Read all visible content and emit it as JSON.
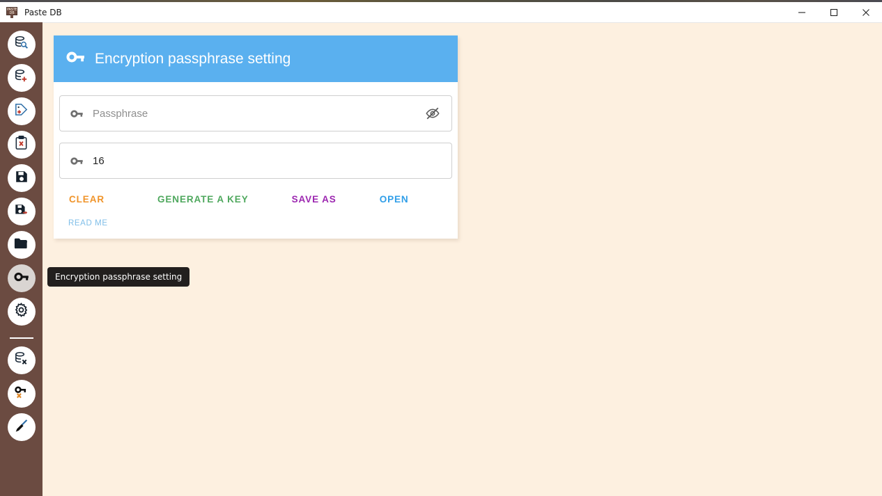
{
  "window": {
    "title": "Paste DB",
    "app_icon": "paste-db-sign-icon",
    "controls": {
      "minimize": "minimize-icon",
      "maximize": "maximize-icon",
      "close": "close-icon"
    }
  },
  "colors": {
    "sidebar_bg": "#6B4B41",
    "page_bg": "#FDF0E0",
    "header_blue": "#5AB0EF",
    "clear": "#F0942A",
    "generate": "#4FA85E",
    "save_as": "#9C27B0",
    "open": "#2F9EE8",
    "read_me": "#7FBEE8",
    "tooltip_bg": "#221F1E"
  },
  "sidebar": {
    "items": [
      {
        "name": "search-database",
        "icon": "database-search-icon",
        "active": false
      },
      {
        "name": "add-database",
        "icon": "database-add-icon",
        "active": false
      },
      {
        "name": "add-tag",
        "icon": "tag-add-icon",
        "active": false
      },
      {
        "name": "clear-clipboard",
        "icon": "clipboard-x-icon",
        "active": false
      },
      {
        "name": "save",
        "icon": "floppy-save-icon",
        "active": false
      },
      {
        "name": "save-as",
        "icon": "floppy-save-as-icon",
        "active": false
      },
      {
        "name": "open-file",
        "icon": "folder-open-icon",
        "active": false
      },
      {
        "name": "encryption-passphrase",
        "icon": "key-icon",
        "active": true
      },
      {
        "name": "settings",
        "icon": "gear-icon",
        "active": false
      }
    ],
    "items_after_divider": [
      {
        "name": "delete-database",
        "icon": "database-delete-icon",
        "active": false
      },
      {
        "name": "delete-key",
        "icon": "key-delete-icon",
        "active": false
      },
      {
        "name": "clean",
        "icon": "broom-icon",
        "active": false
      }
    ]
  },
  "card": {
    "header": {
      "icon": "key-icon",
      "title": "Encryption passphrase setting"
    },
    "passphrase_field": {
      "icon": "key-icon",
      "placeholder": "Passphrase",
      "value": "",
      "toggle_icon": "eye-off-icon"
    },
    "keylength_field": {
      "icon": "key-icon",
      "value": "16"
    },
    "buttons": [
      {
        "name": "clear-button",
        "label": "CLEAR",
        "color": "#F0942A"
      },
      {
        "name": "generate-a-key-button",
        "label": "GENERATE A KEY",
        "color": "#4FA85E"
      },
      {
        "name": "save-as-button",
        "label": "SAVE AS",
        "color": "#9C27B0"
      },
      {
        "name": "open-button",
        "label": "OPEN",
        "color": "#2F9EE8"
      }
    ],
    "read_me": {
      "name": "read-me-button",
      "label": "READ ME",
      "color": "#7FBEE8"
    }
  },
  "tooltip": {
    "text": "Encryption passphrase setting"
  }
}
